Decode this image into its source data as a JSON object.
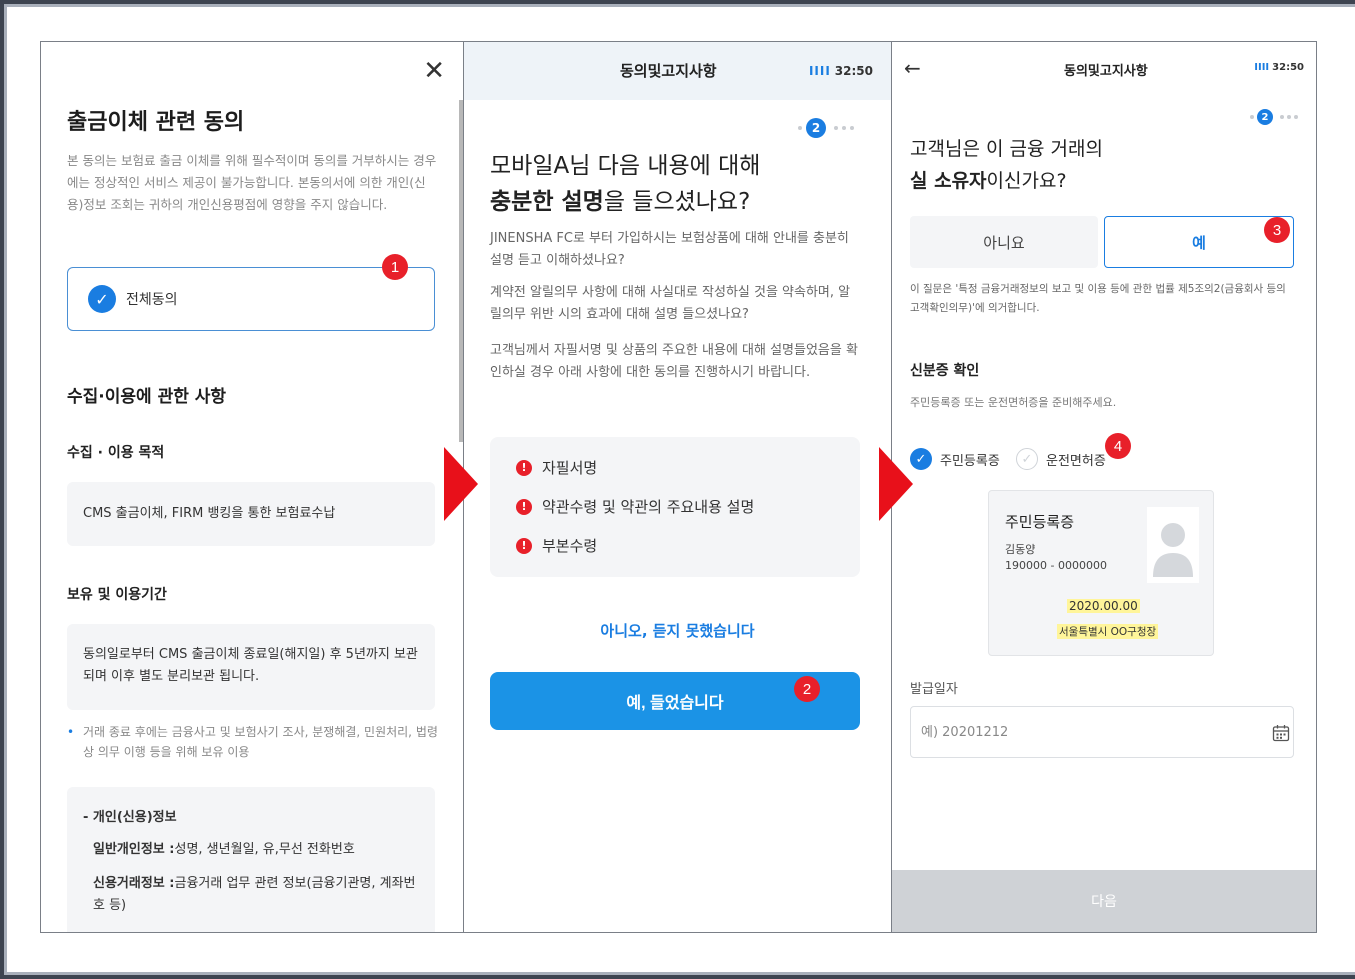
{
  "panel1": {
    "title": "출금이체 관련 동의",
    "description": "본 동의는 보험료 출금 이체를 위해 필수적이며 동의를 거부하시는 경우에는 정상적인 서비스 제공이 불가능합니다. 본동의서에 의한 개인(신용)정보 조회는 귀하의 개인신용평점에 영향을 주지 않습니다.",
    "agree_all": "전체동의",
    "section_title": "수집·이용에 관한 사항",
    "purpose_title": "수집 · 이용 목적",
    "purpose_text": "CMS 출금이체, FIRM 뱅킹을 통한 보험료수납",
    "retention_title": "보유 및 이용기간",
    "retention_text": "동의일로부터 CMS 출금이체 종료일(해지일) 후 5년까지 보관되며 이후 별도 분리보관 됩니다.",
    "retention_note": "거래 종료 후에는 금융사고 및 보험사기 조사, 분쟁해결, 민원처리, 법령상 의무 이행 등을 위해 보유 이용",
    "info_title": "- 개인(신용)정보",
    "info_general_label": "일반개인정보 :",
    "info_general_text": "성명, 생년월일, 유,무선 전화번호",
    "info_credit_label": "신용거래정보 :",
    "info_credit_text": "금융거래 업무 관련 정보(금융기관명, 계좌번호 등)"
  },
  "panel2": {
    "header_title": "동의및고지사항",
    "status_time": "32:50",
    "signal": "IIII",
    "step": "2",
    "question_line1": "모바일A님 다음 내용에 대해",
    "question_bold": "충분한 설명",
    "question_rest": "을 들으셨나요?",
    "para1": "JINENSHA FC로 부터 가입하시는 보험상품에 대해 안내를 충분히 설명 듣고 이해하셨나요?",
    "para2": "계약전 알릴의무 사항에 대해 사실대로 작성하실 것을 약속하며, 알릴의무 위반 시의 효과에 대해 설명 들으셨나요?",
    "para3": "고객님께서 자필서명 및 상품의 주요한 내용에 대해 설명들었음을 확인하실 경우 아래 사항에 대한 동의를 진행하시기 바랍니다.",
    "items": [
      "자필서명",
      "약관수령 및 약관의 주요내용 설명",
      "부본수령"
    ],
    "no_button": "아니오, 듣지 못했습니다",
    "yes_button": "예, 들었습니다"
  },
  "panel3": {
    "header_title": "동의및고지사항",
    "status_time": "32:50",
    "signal": "IIII",
    "step": "2",
    "question_line1": "고객님은 이 금융 거래의",
    "question_bold": "실 소유자",
    "question_rest": "이신가요?",
    "no_button": "아니요",
    "yes_button": "예",
    "legal_note": "이 질문은 '특정 금융거래정보의 보고 및 이용 등에 관한 법률 제5조의2(금융회사 등의 고객확인의무)'에 의거합니다.",
    "id_title": "신분증 확인",
    "id_sub": "주민등록증 또는 운전면허증을 준비해주세요.",
    "option_resident": "주민등록증",
    "option_license": "운전면허증",
    "card_title": "주민등록증",
    "card_name": "김동양",
    "card_number": "190000 - 0000000",
    "card_date": "2020.00.00",
    "card_office": "서울특별시 OO구청장",
    "issue_label": "발급일자",
    "issue_placeholder": "예) 20201212",
    "next_button": "다음"
  },
  "badges": [
    "1",
    "2",
    "3",
    "4"
  ],
  "colors": {
    "accent": "#1a7de1",
    "badge": "#e8202a",
    "arrow": "#e8101a",
    "button_blue": "#1b93e6"
  }
}
